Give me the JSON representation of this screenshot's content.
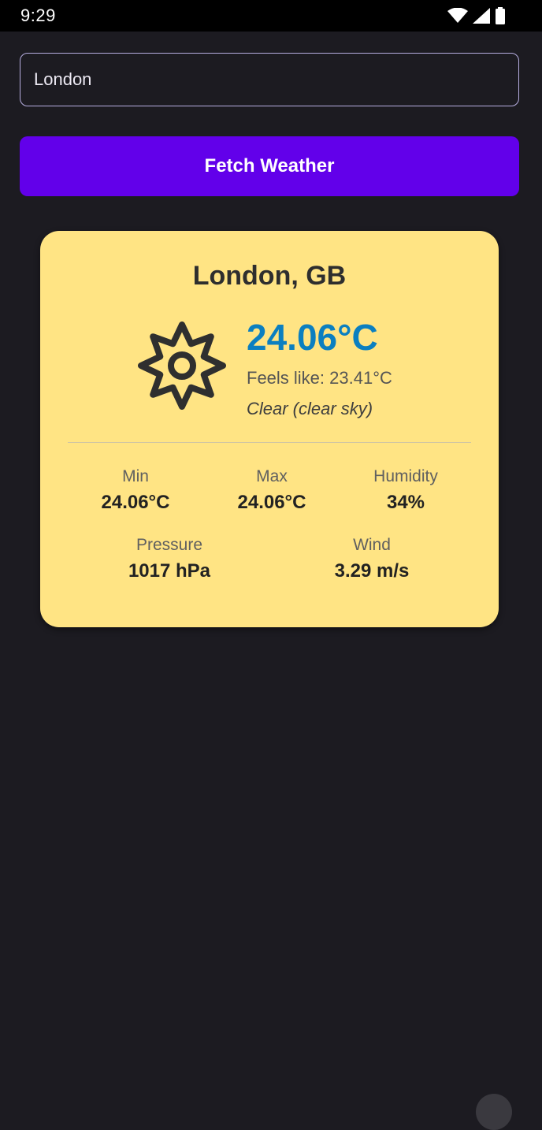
{
  "status_bar": {
    "time": "9:29",
    "icons": [
      "wifi-icon",
      "cellular-signal-icon",
      "battery-icon"
    ]
  },
  "search": {
    "value": "London"
  },
  "fetch_button": {
    "label": "Fetch Weather"
  },
  "weather": {
    "location": "London, GB",
    "condition_icon": "sun-icon",
    "temperature": "24.06°C",
    "feels_like": "Feels like: 23.41°C",
    "description": "Clear (clear sky)",
    "stats": [
      {
        "label": "Min",
        "value": "24.06°C"
      },
      {
        "label": "Max",
        "value": "24.06°C"
      },
      {
        "label": "Humidity",
        "value": "34%"
      },
      {
        "label": "Pressure",
        "value": "1017 hPa"
      },
      {
        "label": "Wind",
        "value": "3.29 m/s"
      }
    ]
  },
  "colors": {
    "background": "#1c1b21",
    "accent": "#6200ea",
    "card": "#ffe484",
    "temperature": "#0b7fc0"
  }
}
